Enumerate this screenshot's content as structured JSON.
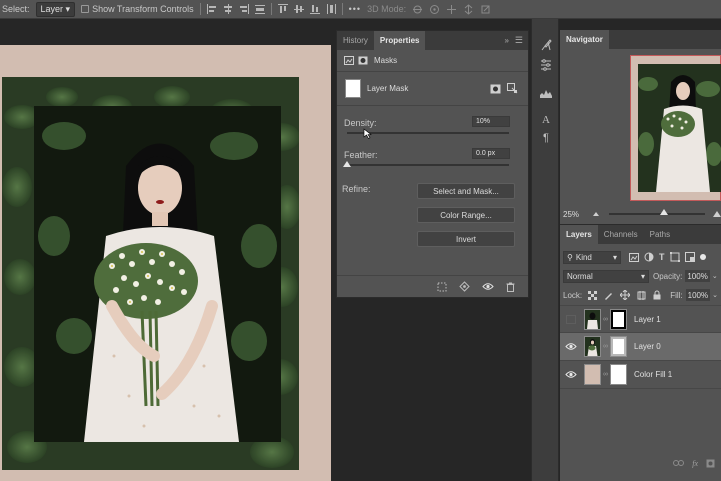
{
  "options_bar": {
    "select_label": "Select:",
    "select_value": "Layer",
    "transform_label": "Show Transform Controls",
    "mode_label": "3D Mode:"
  },
  "properties": {
    "tabs": [
      "History",
      "Properties"
    ],
    "section_label": "Masks",
    "layer_mask_label": "Layer Mask",
    "density_label": "Density:",
    "density_value": "10%",
    "density_fraction": 0.1,
    "feather_label": "Feather:",
    "feather_value": "0.0 px",
    "feather_fraction": 0.0,
    "refine_label": "Refine:",
    "buttons": [
      "Select and Mask...",
      "Color Range...",
      "Invert"
    ]
  },
  "navigator": {
    "title": "Navigator",
    "zoom": "25%",
    "zoom_fraction": 0.55
  },
  "layers_panel": {
    "tabs": [
      "Layers",
      "Channels",
      "Paths"
    ],
    "filter_kind": "Kind",
    "blend_mode": "Normal",
    "opacity_label": "Opacity:",
    "opacity_value": "100%",
    "lock_label": "Lock:",
    "fill_label": "Fill:",
    "fill_value": "100%",
    "layers": [
      {
        "name": "Layer 1",
        "visible": false,
        "selected": false
      },
      {
        "name": "Layer 0",
        "visible": true,
        "selected": true
      },
      {
        "name": "Color Fill 1",
        "visible": true,
        "selected": false
      }
    ]
  },
  "colors": {
    "canvas_bg": "#d2bdb1",
    "panel": "#535353",
    "dark": "#262626",
    "selected_row": "#6a6a6a"
  }
}
